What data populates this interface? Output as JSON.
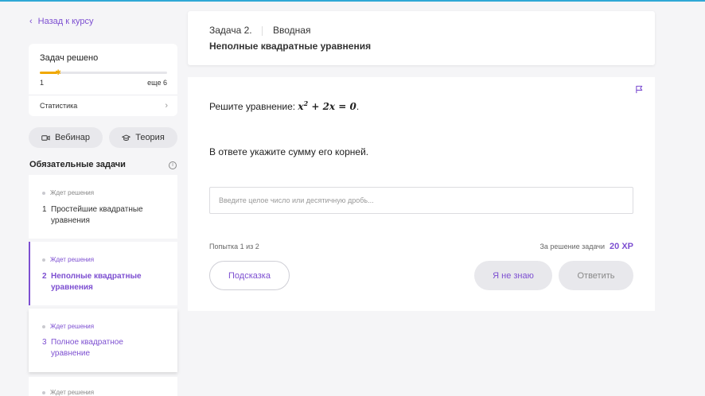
{
  "sidebar": {
    "back_label": "Назад к курсу",
    "progress": {
      "title": "Задач решено",
      "solved": "1",
      "remaining": "еще 6",
      "fraction": 0.14,
      "stats_label": "Статистика"
    },
    "webinar_label": "Вебинар",
    "theory_label": "Теория",
    "required_title": "Обязательные задачи",
    "tasks": [
      {
        "status": "Ждет решения",
        "num": "1",
        "name": "Простейшие квадратные уравнения"
      },
      {
        "status": "Ждет решения",
        "num": "2",
        "name": "Неполные квадратные уравнения"
      },
      {
        "status": "Ждет решения",
        "num": "3",
        "name": "Полное квадратное уравнение"
      },
      {
        "status": "Ждет решения"
      }
    ]
  },
  "header": {
    "task_number": "Задача 2.",
    "task_type": "Вводная",
    "task_title": "Неполные квадратные уравнения"
  },
  "problem": {
    "statement_prefix": "Решите уравнение: ",
    "equation_x": "x",
    "equation_exp": "2",
    "equation_rest": " + 2x = 0",
    "statement_suffix": ".",
    "instruction": "В ответе укажите сумму его корней.",
    "input_placeholder": "Введите целое число или десятичную дробь...",
    "attempt": "Попытка 1 из 2",
    "reward_label": "За решение задачи",
    "reward_xp": "20 XP",
    "hint_label": "Подсказка",
    "dont_know_label": "Я не знаю",
    "submit_label": "Ответить"
  },
  "colors": {
    "accent": "#7d4fd1",
    "progress": "#f0a800",
    "top_line": "#2fa8d6"
  }
}
